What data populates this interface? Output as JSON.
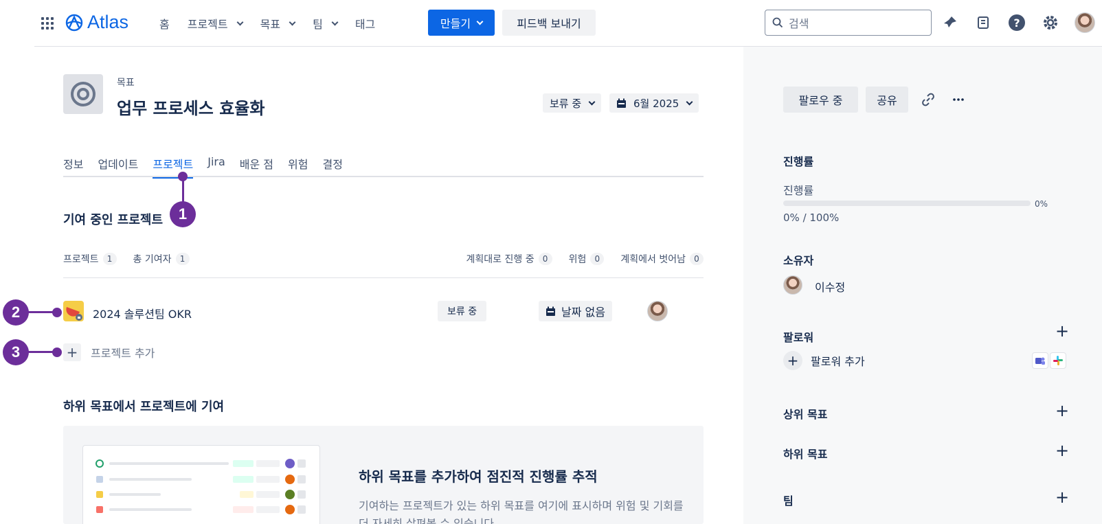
{
  "app": {
    "name": "Atlas"
  },
  "nav": {
    "home": "홈",
    "projects": "프로젝트",
    "goals": "목표",
    "teams": "팀",
    "tags": "태그",
    "create": "만들기",
    "feedback": "피드백 보내기",
    "search_placeholder": "검색"
  },
  "goal": {
    "kicker": "목표",
    "title": "업무 프로세스 효율화",
    "status": "보류 중",
    "target_date": "6월 2025"
  },
  "tabs": [
    "정보",
    "업데이트",
    "프로젝트",
    "Jira",
    "배운 점",
    "위험",
    "결정"
  ],
  "contributing": {
    "title": "기여 중인 프로젝트",
    "stats_left": [
      {
        "label": "프로젝트",
        "count": "1"
      },
      {
        "label": "총 기여자",
        "count": "1"
      }
    ],
    "stats_right": [
      {
        "label": "계획대로 진행 중",
        "count": "0"
      },
      {
        "label": "위험",
        "count": "0"
      },
      {
        "label": "계획에서 벗어남",
        "count": "0"
      }
    ],
    "project": {
      "name": "2024 솔루션팀 OKR",
      "status": "보류 중",
      "date": "날짜 없음"
    },
    "add_project": "프로젝트 추가"
  },
  "subgoals": {
    "title": "하위 목표에서 프로젝트에 기여",
    "empty_title": "하위 목표를 추가하여 점진적 진행률 추적",
    "empty_desc": "기여하는 프로젝트가 있는 하위 목표를 여기에 표시하며 위험 및 기회를 더 자세히 살펴볼 수 있습니다."
  },
  "callouts": [
    "1",
    "2",
    "3"
  ],
  "sidebar": {
    "following": "팔로우 중",
    "share": "공유",
    "progress_heading": "진행률",
    "progress_label": "진행률",
    "progress_pct": "0%",
    "progress_text": "0% / 100%",
    "progress_value": 0,
    "owner_heading": "소유자",
    "owner_name": "이수정",
    "followers_heading": "팔로워",
    "add_follower": "팔로워 추가",
    "parent_goal": "상위 목표",
    "sub_goal": "하위 목표",
    "team": "팀"
  },
  "colors": {
    "accent": "#0c66e4",
    "callout": "#6c2e9a",
    "project_icon": "#f5cd47"
  }
}
